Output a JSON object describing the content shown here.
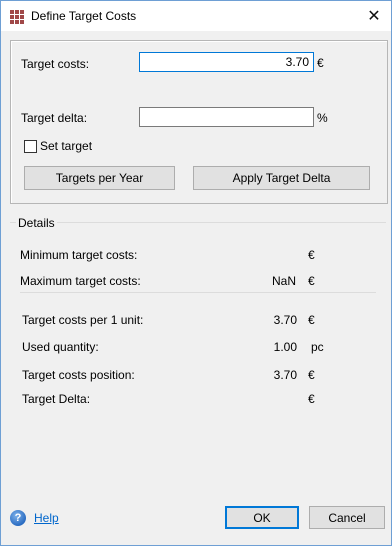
{
  "window": {
    "title": "Define Target Costs",
    "close_glyph": "✕",
    "accent_color": "#0078d7"
  },
  "form": {
    "target_costs_label": "Target costs:",
    "target_costs_value": "3.70",
    "target_costs_unit": "€",
    "target_delta_label": "Target delta:",
    "target_delta_value": "",
    "target_delta_unit": "%",
    "set_target_label": "Set target",
    "set_target_checked": false,
    "targets_per_year_label": "Targets per Year",
    "apply_target_delta_label": "Apply Target Delta"
  },
  "details": {
    "caption": "Details",
    "min_label": "Minimum target costs:",
    "min_value": "",
    "min_unit": "€",
    "max_label": "Maximum target costs:",
    "max_value": "NaN",
    "max_unit": "€",
    "per_unit_label": "Target costs per 1 unit:",
    "per_unit_value": "3.70",
    "per_unit_unit": "€",
    "used_quantity_label": "Used quantity:",
    "used_quantity_value": "1.00",
    "used_quantity_unit": "pc",
    "position_label": "Target costs position:",
    "position_value": "3.70",
    "position_unit": "€",
    "delta_label": "Target Delta:",
    "delta_value": "",
    "delta_unit": "€"
  },
  "footer": {
    "help_icon_glyph": "?",
    "help_label": "Help",
    "ok_label": "OK",
    "cancel_label": "Cancel"
  }
}
